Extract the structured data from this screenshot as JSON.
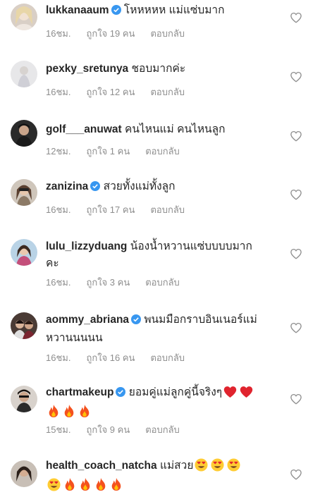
{
  "comments": [
    {
      "username": "lukkanaaum",
      "verified": true,
      "text": "โหหหหห แม่แซ่บมาก",
      "time": "16ชม.",
      "likes": "ถูกใจ 19 คน",
      "reply": "ตอบกลับ"
    },
    {
      "username": "pexky_sretunya",
      "verified": false,
      "text": "ชอบมากค่ะ",
      "time": "16ชม.",
      "likes": "ถูกใจ 12 คน",
      "reply": "ตอบกลับ"
    },
    {
      "username": "golf___anuwat",
      "verified": false,
      "text": "คนไหนแม่ คนไหนลูก",
      "time": "12ชม.",
      "likes": "ถูกใจ 1 คน",
      "reply": "ตอบกลับ"
    },
    {
      "username": "zanizina",
      "verified": true,
      "text": "สวยทั้งแม่ทั้งลูก",
      "time": "16ชม.",
      "likes": "ถูกใจ 17 คน",
      "reply": "ตอบกลับ"
    },
    {
      "username": "lulu_lizzyduang",
      "verified": false,
      "text": "น้องน้ำหวานแซ่บบบบมาก",
      "text_line2": "คะ",
      "time": "16ชม.",
      "likes": "ถูกใจ 3 คน",
      "reply": "ตอบกลับ"
    },
    {
      "username": "aommy_abriana",
      "verified": true,
      "text": "พนมมือกราบอินเนอร์แม่",
      "text_line2": "หวานนนนน",
      "time": "16ชม.",
      "likes": "ถูกใจ 16 คน",
      "reply": "ตอบกลับ"
    },
    {
      "username": "chartmakeup",
      "verified": true,
      "text": "ยอมคู่แม่ลูกคู่นี้จริงๆ",
      "emoji_line1": [
        "heart",
        "heart"
      ],
      "emoji_line2": [
        "fire",
        "fire",
        "fire"
      ],
      "time": "15ชม.",
      "likes": "ถูกใจ 9 คน",
      "reply": "ตอบกลับ"
    },
    {
      "username": "health_coach_natcha",
      "verified": false,
      "text": "แม่สวย",
      "emoji_line1": [
        "heart-eyes",
        "heart-eyes",
        "heart-eyes"
      ],
      "emoji_line2": [
        "heart-eyes",
        "fire",
        "fire",
        "fire",
        "fire"
      ]
    }
  ],
  "icons": {
    "like": "heart-outline-icon",
    "verified": "verified-badge-icon"
  },
  "colors": {
    "verified": "#3897f0",
    "meta": "#8e8e8e",
    "text": "#262626"
  }
}
